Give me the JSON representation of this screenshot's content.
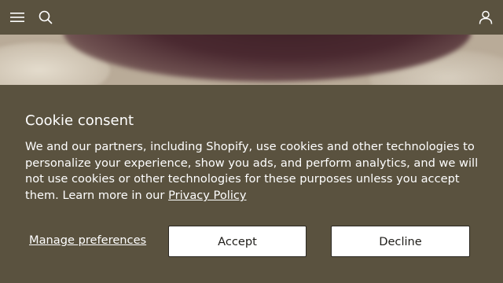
{
  "header": {
    "menu_icon": "hamburger-menu-icon",
    "search_icon": "search-icon",
    "account_icon": "account-icon",
    "background": "#5a523f"
  },
  "cookie_banner": {
    "title": "Cookie consent",
    "body_text": "We and our partners, including Shopify, use cookies and other technologies to personalize your experience, show you ads, and perform analytics, and we will not use cookies or other technologies for these purposes unless you accept them. Learn more in our ",
    "privacy_link": "Privacy Policy",
    "manage_label": "Manage preferences",
    "accept_label": "Accept",
    "decline_label": "Decline"
  },
  "colors": {
    "banner_background": "#5a523f",
    "text": "#ffffff",
    "button_background": "#ffffff"
  }
}
